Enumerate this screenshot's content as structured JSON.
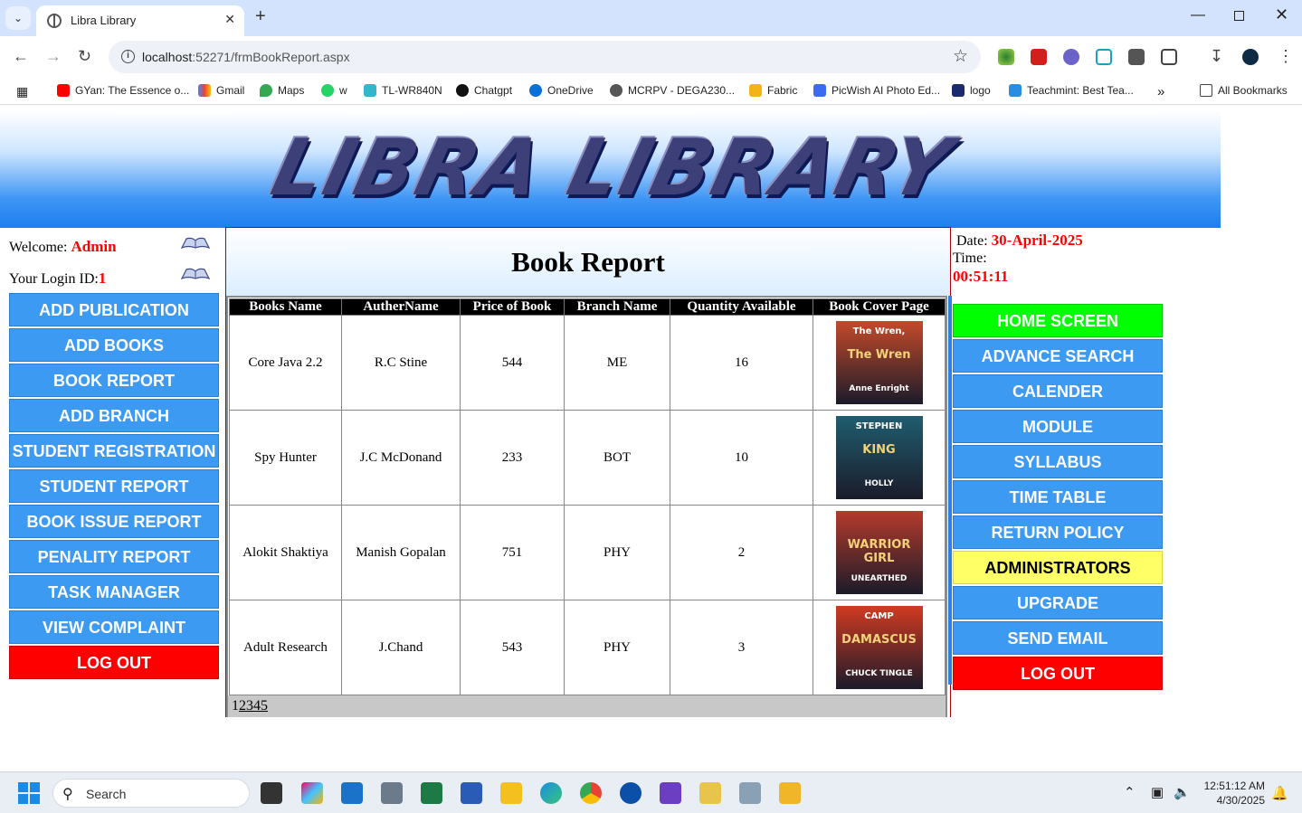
{
  "browser": {
    "tab_title": "Libra Library",
    "url_host": "localhost",
    "url_rest": ":52271/frmBookReport.aspx",
    "bookmarks": [
      "GYan: The Essence o...",
      "Gmail",
      "Maps",
      "w",
      "TL-WR840N",
      "Chatgpt",
      "OneDrive",
      "MCRPV - DEGA230...",
      "Fabric",
      "PicWish AI Photo Ed...",
      "logo",
      "Teachmint: Best Tea...",
      "All Bookmarks"
    ]
  },
  "banner": {
    "logo_text": "LIBRA LIBRARY"
  },
  "left": {
    "welcome_label": "Welcome: ",
    "welcome_name": "Admin",
    "login_label": "Your Login ID:",
    "login_id": "1",
    "menu": [
      "ADD PUBLICATION",
      "ADD BOOKS",
      "BOOK REPORT",
      "ADD BRANCH",
      "STUDENT REGISTRATION",
      "STUDENT REPORT",
      "BOOK ISSUE REPORT",
      "PENALITY REPORT",
      "TASK MANAGER",
      "VIEW COMPLAINT",
      "LOG OUT"
    ]
  },
  "report": {
    "title": "Book Report",
    "columns": [
      "Books Name",
      "AutherName",
      "Price of Book",
      "Branch Name",
      "Quantity Available",
      "Book Cover Page"
    ],
    "rows": [
      {
        "name": "Core Java 2.2",
        "author": "R.C Stine",
        "price": "544",
        "branch": "ME",
        "qty": "16",
        "cover": {
          "line1": "The Wren,",
          "line2": "The Wren",
          "line3": "Anne Enright",
          "bg": "#c44a2a"
        }
      },
      {
        "name": "Spy Hunter",
        "author": "J.C McDonand",
        "price": "233",
        "branch": "BOT",
        "qty": "10",
        "cover": {
          "line1": "STEPHEN",
          "line2": "KING",
          "line3": "HOLLY",
          "bg": "#1f5d6f"
        }
      },
      {
        "name": "Alokit Shaktiya",
        "author": "Manish Gopalan",
        "price": "751",
        "branch": "PHY",
        "qty": "2",
        "cover": {
          "line1": "",
          "line2": "WARRIOR GIRL",
          "line3": "UNEARTHED",
          "bg": "#b53a2c"
        }
      },
      {
        "name": "Adult Research",
        "author": "J.Chand",
        "price": "543",
        "branch": "PHY",
        "qty": "3",
        "cover": {
          "line1": "CAMP",
          "line2": "DAMASCUS",
          "line3": "CHUCK TINGLE",
          "bg": "#d13a22"
        }
      }
    ],
    "pager": [
      "1",
      "2",
      "3",
      "4",
      "5"
    ]
  },
  "right": {
    "date_label": "Date: ",
    "date_value": "30-April-2025",
    "time_label": "Time:",
    "time_value": "00:51:11",
    "menu": [
      {
        "label": "HOME SCREEN",
        "style": "green"
      },
      {
        "label": "ADVANCE SEARCH",
        "style": "blue"
      },
      {
        "label": "CALENDER",
        "style": "blue"
      },
      {
        "label": "MODULE",
        "style": "blue"
      },
      {
        "label": "SYLLABUS",
        "style": "blue"
      },
      {
        "label": "TIME TABLE",
        "style": "blue"
      },
      {
        "label": "RETURN POLICY",
        "style": "blue"
      },
      {
        "label": "ADMINISTRATORS",
        "style": "yellow"
      },
      {
        "label": "UPGRADE",
        "style": "blue"
      },
      {
        "label": "SEND EMAIL",
        "style": "blue"
      },
      {
        "label": "LOG OUT",
        "style": "red"
      }
    ]
  },
  "taskbar": {
    "search_placeholder": "Search",
    "clock_time": "12:51:12 AM",
    "clock_date": "4/30/2025"
  },
  "colors": {
    "menu_blue": "#3d9af2",
    "logout_red": "#ff0000",
    "home_green": "#00ff00",
    "admin_yellow": "#ffff66",
    "accent_red_text": "#ff0000"
  }
}
